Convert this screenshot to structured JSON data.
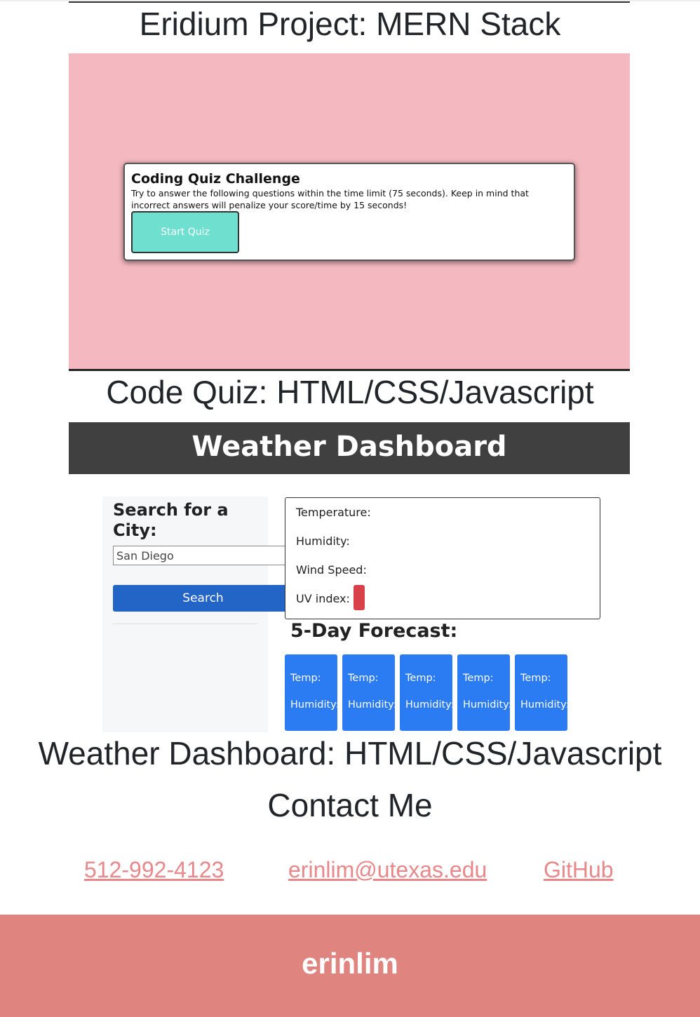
{
  "projects": [
    {
      "caption": "Eridium Project: MERN Stack"
    },
    {
      "caption": "Code Quiz: HTML/CSS/Javascript",
      "preview": {
        "title": "Coding Quiz Challenge",
        "description": "Try to answer the following questions within the time limit (75 seconds). Keep in mind that incorrect answers will penalize your score/time by 15 seconds!",
        "button": "Start Quiz"
      }
    },
    {
      "caption": "Weather Dashboard: HTML/CSS/Javascript",
      "preview": {
        "header": "Weather Dashboard",
        "search_title": "Search for a City:",
        "search_value": "San Diego",
        "search_button": "Search",
        "temperature": "Temperature:",
        "humidity": "Humidity:",
        "wind": "Wind Speed:",
        "uv": "UV index:",
        "forecast_title": "5-Day Forecast:",
        "forecast": [
          {
            "temp": "Temp:",
            "humidity": "Humidity:"
          },
          {
            "temp": "Temp:",
            "humidity": "Humidity:"
          },
          {
            "temp": "Temp:",
            "humidity": "Humidity:"
          },
          {
            "temp": "Temp:",
            "humidity": "Humidity:"
          },
          {
            "temp": "Temp:",
            "humidity": "Humidity:"
          }
        ]
      }
    }
  ],
  "contact": {
    "heading": "Contact Me",
    "phone": "512-992-4123",
    "email": "erinlim@utexas.edu",
    "github": "GitHub"
  },
  "footer": {
    "name": "erinlim"
  },
  "colors": {
    "link": "#e8888a",
    "footer_bg": "#e0847f",
    "quiz_bg": "#f4b8c0",
    "forecast_card": "#2b7bf3"
  }
}
